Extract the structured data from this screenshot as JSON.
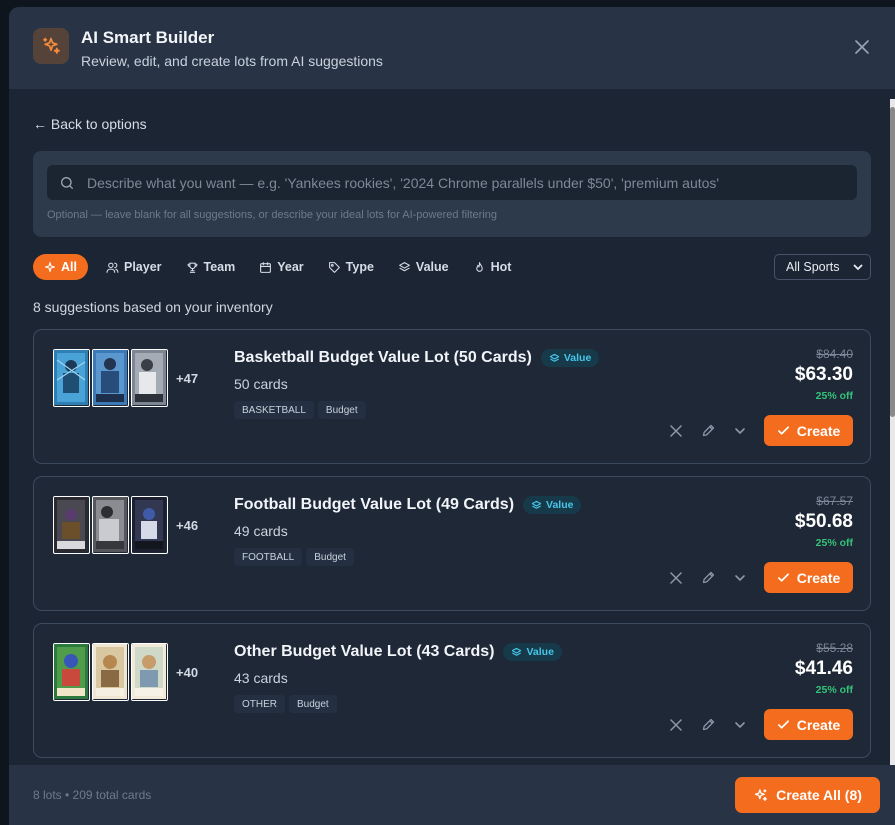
{
  "colors": {
    "accent": "#f46d1e",
    "modal_bg": "#1c2533",
    "header_bg": "#283446",
    "value_badge": "#46c6e8",
    "discount": "#35c27a"
  },
  "header": {
    "icon": "sparkles-icon",
    "title": "AI Smart Builder",
    "subtitle": "Review, edit, and create lots from AI suggestions",
    "close_icon": "close-icon"
  },
  "back_link": "← Back to options",
  "search": {
    "placeholder": "Describe what you want — e.g. 'Yankees rookies', '2024 Chrome parallels under $50', 'premium autos'",
    "value": "",
    "hint": "Optional — leave blank for all suggestions, or describe your ideal lots for AI-powered filtering"
  },
  "filters": [
    {
      "label": "All",
      "icon": "sparkle-icon",
      "active": true
    },
    {
      "label": "Player",
      "icon": "users-icon",
      "active": false
    },
    {
      "label": "Team",
      "icon": "trophy-icon",
      "active": false
    },
    {
      "label": "Year",
      "icon": "calendar-icon",
      "active": false
    },
    {
      "label": "Type",
      "icon": "tag-icon",
      "active": false
    },
    {
      "label": "Value",
      "icon": "layers-icon",
      "active": false
    },
    {
      "label": "Hot",
      "icon": "flame-icon",
      "active": false
    }
  ],
  "sport_select": {
    "selected": "All Sports"
  },
  "summary": "8 suggestions based on your inventory",
  "lots": [
    {
      "title": "Basketball Budget Value Lot (50 Cards)",
      "badge": "Value",
      "count": "50 cards",
      "more": "+47",
      "tags": [
        "BASKETBALL",
        "Budget"
      ],
      "old_price": "$84.40",
      "new_price": "$63.30",
      "discount": "25% off",
      "create_label": "Create"
    },
    {
      "title": "Football Budget Value Lot (49 Cards)",
      "badge": "Value",
      "count": "49 cards",
      "more": "+46",
      "tags": [
        "FOOTBALL",
        "Budget"
      ],
      "old_price": "$67.57",
      "new_price": "$50.68",
      "discount": "25% off",
      "create_label": "Create"
    },
    {
      "title": "Other Budget Value Lot (43 Cards)",
      "badge": "Value",
      "count": "43 cards",
      "more": "+40",
      "tags": [
        "OTHER",
        "Budget"
      ],
      "old_price": "$55.28",
      "new_price": "$41.46",
      "discount": "25% off",
      "create_label": "Create"
    }
  ],
  "footer": {
    "stats": "8 lots • 209 total cards",
    "create_all": "Create All (8)"
  }
}
